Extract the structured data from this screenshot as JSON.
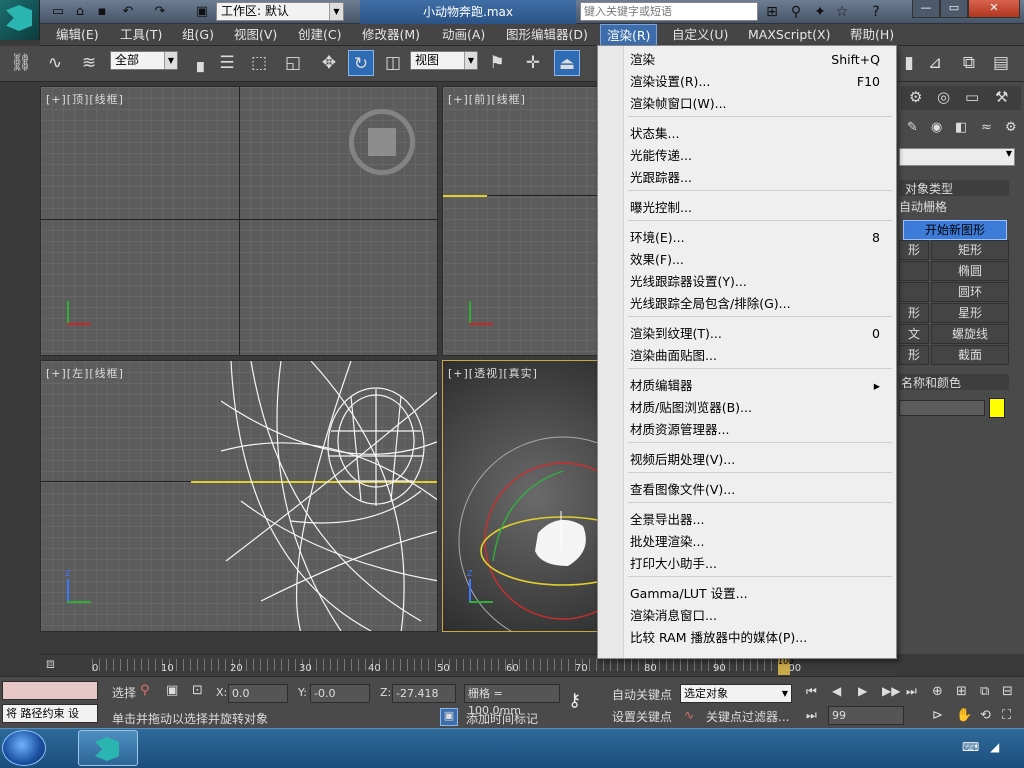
{
  "titlebar": {
    "workspace": "工作区: 默认",
    "doc_title": "小动物奔跑.max",
    "search_placeholder": "键入关键字或短语"
  },
  "menubar": {
    "items": [
      "编辑(E)",
      "工具(T)",
      "组(G)",
      "视图(V)",
      "创建(C)",
      "修改器(M)",
      "动画(A)",
      "图形编辑器(D)",
      "渲染(R)",
      "自定义(U)",
      "MAXScript(X)",
      "帮助(H)"
    ]
  },
  "toolbar": {
    "selection_filter": "全部",
    "ref_coord": "视图"
  },
  "viewports": {
    "top": "[+][顶][线框]",
    "front": "[+][前][线框]",
    "left": "[+][左][线框]",
    "persp": "[+][透视][真实]"
  },
  "render_menu": {
    "items": [
      {
        "label": "渲染",
        "shortcut": "Shift+Q"
      },
      {
        "label": "渲染设置(R)...",
        "shortcut": "F10"
      },
      {
        "label": "渲染帧窗口(W)...",
        "shortcut": ""
      },
      {
        "label": "状态集...",
        "shortcut": ""
      },
      {
        "label": "光能传递...",
        "shortcut": ""
      },
      {
        "label": "光跟踪器...",
        "shortcut": ""
      },
      {
        "label": "曝光控制...",
        "shortcut": ""
      },
      {
        "label": "环境(E)...",
        "shortcut": "8"
      },
      {
        "label": "效果(F)...",
        "shortcut": ""
      },
      {
        "label": "光线跟踪器设置(Y)...",
        "shortcut": ""
      },
      {
        "label": "光线跟踪全局包含/排除(G)...",
        "shortcut": ""
      },
      {
        "label": "渲染到纹理(T)...",
        "shortcut": "0"
      },
      {
        "label": "渲染曲面贴图...",
        "shortcut": ""
      },
      {
        "label": "材质编辑器",
        "shortcut": "▸"
      },
      {
        "label": "材质/贴图浏览器(B)...",
        "shortcut": ""
      },
      {
        "label": "材质资源管理器...",
        "shortcut": ""
      },
      {
        "label": "视频后期处理(V)...",
        "shortcut": ""
      },
      {
        "label": "查看图像文件(V)...",
        "shortcut": ""
      },
      {
        "label": "全景导出器...",
        "shortcut": ""
      },
      {
        "label": "批处理渲染...",
        "shortcut": ""
      },
      {
        "label": "打印大小助手...",
        "shortcut": ""
      },
      {
        "label": "Gamma/LUT 设置...",
        "shortcut": ""
      },
      {
        "label": "渲染消息窗口...",
        "shortcut": ""
      },
      {
        "label": "比较 RAM 播放器中的媒体(P)...",
        "shortcut": ""
      }
    ]
  },
  "command_panel": {
    "object_type": "对象类型",
    "auto_grid": "自动栅格",
    "start_new_shape": "开始新图形",
    "buttons": [
      "矩形",
      "椭圆",
      "圆环",
      "星形",
      "螺旋线",
      "截面"
    ],
    "partial_buttons": [
      "形",
      "文",
      "形"
    ],
    "name_color": "名称和颜色",
    "swatch_color": "#ffff00"
  },
  "timeline": {
    "ticks": [
      "0",
      "10",
      "20",
      "30",
      "40",
      "50",
      "60",
      "70",
      "80",
      "90",
      "100"
    ],
    "frame_counter": "100"
  },
  "status": {
    "left_field": "将 路径约束 设",
    "select_btn": "选择",
    "x_label": "X:",
    "x_value": "0.0",
    "y_label": "Y:",
    "y_value": "-0.0",
    "z_label": "Z:",
    "z_value": "-27.418",
    "grid": "栅格 = 100.0mm",
    "hint": "单击并拖动以选择并旋转对象",
    "add_time_tag": "添加时间标记",
    "auto_key": "自动关键点",
    "set_key": "设置关键点",
    "selected_obj": "选定对象",
    "key_filters": "关键点过滤器...",
    "frame": "99"
  }
}
